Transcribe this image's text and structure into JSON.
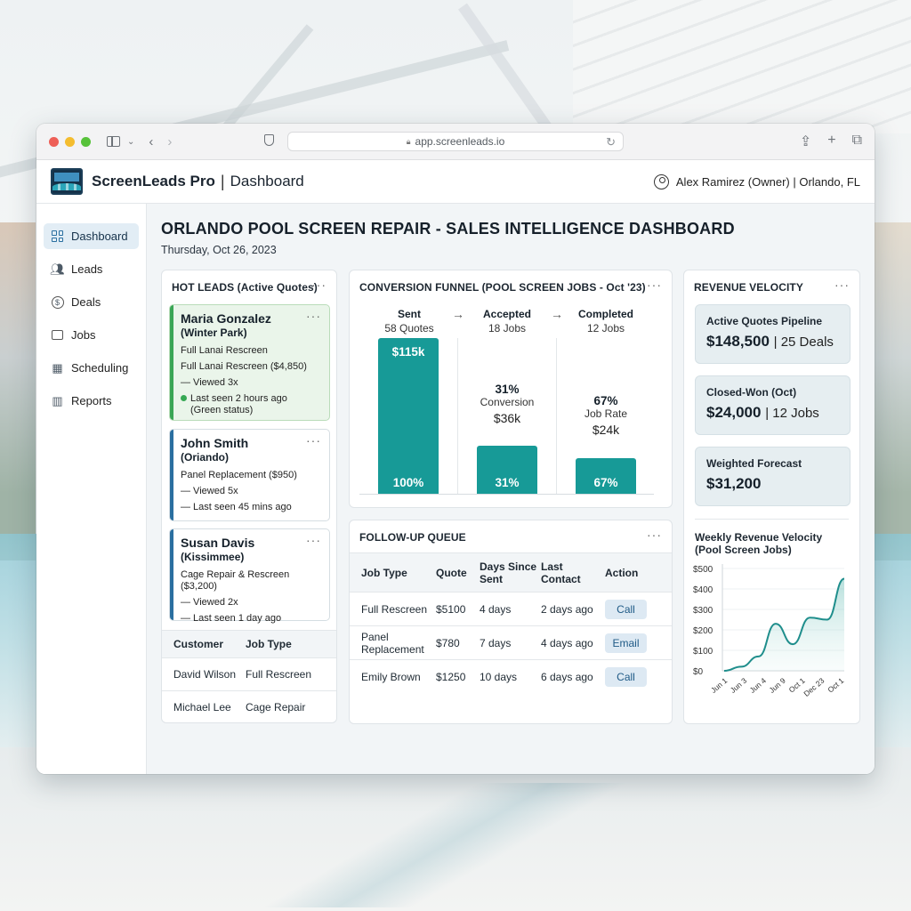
{
  "browser": {
    "url": "app.screenleads.io"
  },
  "header": {
    "brand": "ScreenLeads Pro",
    "separator": "|",
    "page": "Dashboard",
    "user": "Alex Ramirez (Owner) | Orlando, FL"
  },
  "sidebar": {
    "items": [
      {
        "label": "Dashboard",
        "icon": "grid-icon"
      },
      {
        "label": "Leads",
        "icon": "users-icon"
      },
      {
        "label": "Deals",
        "icon": "dollar-icon"
      },
      {
        "label": "Jobs",
        "icon": "briefcase-icon"
      },
      {
        "label": "Scheduling",
        "icon": "calendar-icon"
      },
      {
        "label": "Reports",
        "icon": "bar-chart-icon"
      }
    ]
  },
  "main": {
    "title": "ORLANDO POOL SCREEN REPAIR - SALES INTELLIGENCE DASHBOARD",
    "date": "Thursday, Oct 26, 2023"
  },
  "hot_leads": {
    "title": "HOT LEADS (Active Quotes)",
    "more": "···",
    "leads": [
      {
        "name": "Maria Gonzalez",
        "location": "(Winter Park)",
        "lines": [
          "Full Lanai Rescreen",
          "Full Lanai Rescreen ($4,850)",
          "— Viewed 3x"
        ],
        "status": "Last seen 2 hours ago",
        "status_note": "(Green status)"
      },
      {
        "name": "John Smith",
        "location": "(Oriando)",
        "lines": [
          "Panel Replacement ($950)",
          "— Viewed 5x",
          "— Last seen 45 mins ago"
        ]
      },
      {
        "name": "Susan Davis",
        "location": "(Kissimmee)",
        "lines": [
          "Cage Repair & Rescreen ($3,200)",
          "— Viewed 2x",
          "— Last seen 1 day ago"
        ]
      }
    ],
    "table": {
      "headers": [
        "Customer",
        "Job Type"
      ],
      "rows": [
        [
          "David Wilson",
          "Full Rescreen"
        ],
        [
          "Michael Lee",
          "Cage Repair"
        ]
      ]
    }
  },
  "funnel": {
    "title": "CONVERSION FUNNEL (POOL SCREEN JOBS - Oct '23)",
    "arrow": "→",
    "stages": [
      {
        "name": "Sent",
        "count": "58 Quotes",
        "bar_top": "$115k",
        "bar_bottom": "100%",
        "fill": 1.0
      },
      {
        "name": "Accepted",
        "count": "18 Jobs",
        "rate": "31%",
        "rate_label": "Conversion",
        "amount": "$36k",
        "bar_bottom": "31%",
        "fill": 0.31
      },
      {
        "name": "Completed",
        "count": "12 Jobs",
        "rate": "67%",
        "rate_label": "Job Rate",
        "amount": "$24k",
        "bar_bottom": "67%",
        "fill": 0.23
      }
    ]
  },
  "follow_up": {
    "title": "FOLLOW-UP QUEUE",
    "headers": [
      "Job Type",
      "Quote",
      "Days Since Sent",
      "Last Contact",
      "Action"
    ],
    "rows": [
      {
        "job": "Full Rescreen",
        "quote": "$5100",
        "days": "4 days",
        "contact": "2 days ago",
        "action": "Call"
      },
      {
        "job": "Panel Replacement",
        "quote": "$780",
        "days": "7 days",
        "contact": "4 days ago",
        "action": "Email"
      },
      {
        "job": "Emily Brown",
        "quote": "$1250",
        "days": "10 days",
        "contact": "6 days ago",
        "action": "Call"
      }
    ]
  },
  "revenue": {
    "title": "REVENUE VELOCITY",
    "kpis": [
      {
        "label": "Active Quotes Pipeline",
        "value": "$148,500",
        "sub": "| 25 Deals"
      },
      {
        "label": "Closed-Won (Oct)",
        "value": "$24,000",
        "sub": "| 12 Jobs"
      },
      {
        "label": "Weighted Forecast",
        "value": "$31,200",
        "sub": ""
      }
    ]
  },
  "chart_data": {
    "type": "area",
    "title": "Weekly Revenue Velocity (Pool Screen Jobs)",
    "x": [
      "Jun 1",
      "Jun 3",
      "Jun 4",
      "Jun 9",
      "Oct 1",
      "Dec 23",
      "Oct 1"
    ],
    "values": [
      0,
      20,
      70,
      230,
      130,
      260,
      250,
      450
    ],
    "yticks": [
      "$0",
      "$100",
      "$200",
      "$300",
      "$400",
      "$500"
    ],
    "ylim": [
      0,
      500
    ],
    "color": "#1f8e8c"
  }
}
